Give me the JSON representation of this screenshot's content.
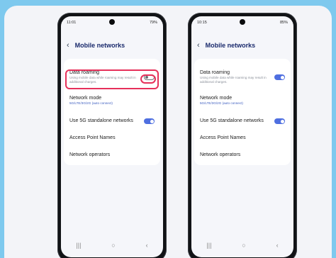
{
  "phones": [
    {
      "status": {
        "time": "11:01",
        "right": "79%"
      },
      "title": "Mobile networks",
      "items": [
        {
          "label": "Data roaming",
          "sub": "Using mobile data while roaming may result in additional charges."
        },
        {
          "label": "Network mode",
          "sub": "5G/LTE/3G/2G (auto connect)"
        },
        {
          "label": "Use 5G standalone networks"
        },
        {
          "label": "Access Point Names"
        },
        {
          "label": "Network operators"
        }
      ],
      "toggles": {
        "data_roaming": "off",
        "use_5g": "on"
      }
    },
    {
      "status": {
        "time": "10:15",
        "right": "85%"
      },
      "title": "Mobile networks",
      "items": [
        {
          "label": "Data roaming",
          "sub": "Using mobile data while roaming may result in additional charges."
        },
        {
          "label": "Network mode",
          "sub": "5G/LTE/3G/2G (auto connect)"
        },
        {
          "label": "Use 5G standalone networks"
        },
        {
          "label": "Access Point Names"
        },
        {
          "label": "Network operators"
        }
      ],
      "toggles": {
        "data_roaming": "on",
        "use_5g": "on"
      }
    }
  ],
  "icons": {
    "back": "chevron-left-icon",
    "nav": [
      "recent-apps-icon",
      "home-icon",
      "back-nav-icon"
    ]
  },
  "colors": {
    "background": "#7ec9ee",
    "accent": "#4f6fe0",
    "highlight": "#e6305a",
    "title": "#1a2a6c"
  }
}
